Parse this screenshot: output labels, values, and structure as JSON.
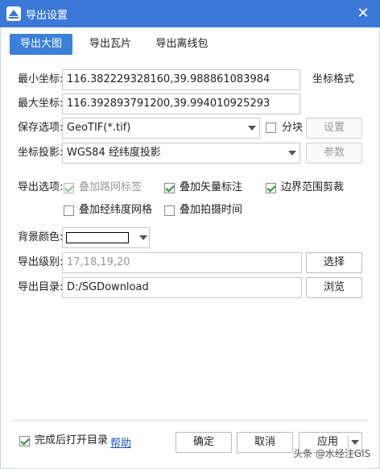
{
  "window": {
    "title": "导出设置",
    "close_glyph": "✕"
  },
  "tabs": [
    {
      "label": "导出大图",
      "active": true
    },
    {
      "label": "导出瓦片",
      "active": false
    },
    {
      "label": "导出离线包",
      "active": false
    }
  ],
  "coords": {
    "min_label": "最小坐标:",
    "min_value": "116.382229328160,39.988861083984",
    "format_label": "坐标格式",
    "max_label": "最大坐标:",
    "max_value": "116.392893791200,39.994010925293"
  },
  "save": {
    "label": "保存选项:",
    "value": "GeoTIF(*.tif)",
    "block_label": "分块",
    "block_checked": false,
    "settings_button": "设置"
  },
  "projection": {
    "label": "坐标投影:",
    "value": "WGS84 经纬度投影",
    "params_button": "参数"
  },
  "export_options": {
    "label": "导出选项:",
    "items": [
      {
        "label": "叠加路网标签",
        "checked": true,
        "disabled": true
      },
      {
        "label": "叠加矢量标注",
        "checked": true,
        "disabled": false
      },
      {
        "label": "边界范围剪裁",
        "checked": true,
        "disabled": false
      },
      {
        "label": "叠加经纬度网格",
        "checked": false,
        "disabled": false
      },
      {
        "label": "叠加拍摄时间",
        "checked": false,
        "disabled": false
      }
    ]
  },
  "background": {
    "label": "背景颜色:",
    "color": "#ffffff"
  },
  "levels": {
    "label": "导出级别:",
    "value": "17,18,19,20",
    "button": "选择"
  },
  "directory": {
    "label": "导出目录:",
    "value": "D:/SGDownload",
    "button": "浏览"
  },
  "footer": {
    "open_dir_label": "完成后打开目录",
    "open_dir_checked": true,
    "help_link": "帮助",
    "ok_button": "确定",
    "cancel_button": "取消",
    "apply_button": "应用"
  },
  "watermark": "头条 @水经注GIS",
  "colors": {
    "titlebar": "#3c78d8",
    "tab_active": "#3b7fd8",
    "link": "#1a56c9",
    "check": "#2f8f46"
  }
}
